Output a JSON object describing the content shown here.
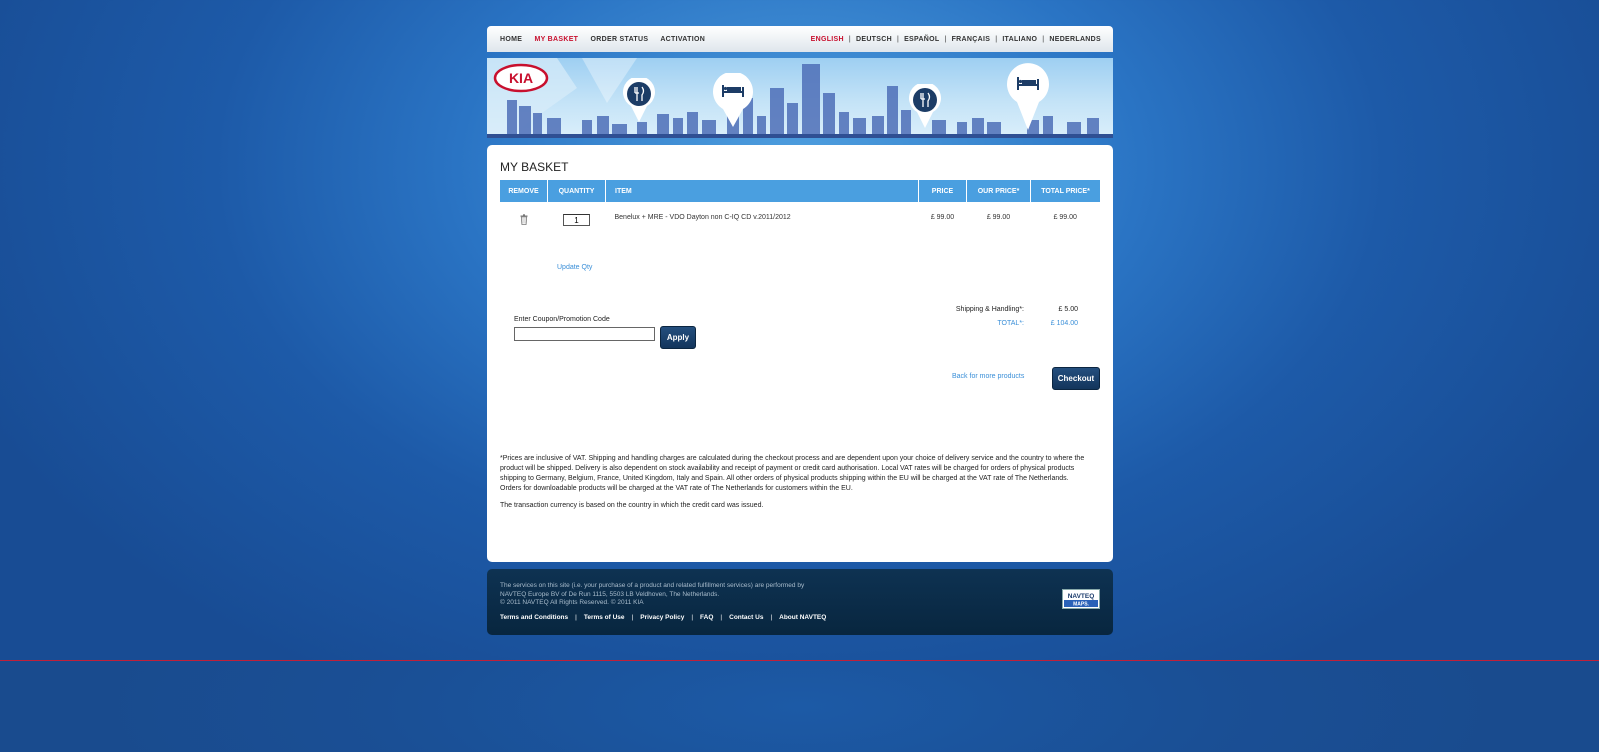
{
  "nav": {
    "items": [
      {
        "label": "HOME",
        "active": false
      },
      {
        "label": "MY BASKET",
        "active": true
      },
      {
        "label": "ORDER STATUS",
        "active": false
      },
      {
        "label": "ACTIVATION",
        "active": false
      }
    ],
    "languages": [
      "ENGLISH",
      "DEUTSCH",
      "ESPAÑOL",
      "FRANÇAIS",
      "ITALIANO",
      "NEDERLANDS"
    ],
    "active_language": "ENGLISH"
  },
  "banner": {
    "logo_text": "KIA",
    "icons": [
      "cutlery-icon",
      "bed-icon",
      "cutlery-icon",
      "bed-icon"
    ]
  },
  "basket": {
    "title": "MY BASKET",
    "columns": [
      "REMOVE",
      "QUANTITY",
      "ITEM",
      "PRICE",
      "OUR PRICE*",
      "TOTAL PRICE*"
    ],
    "rows": [
      {
        "quantity": "1",
        "item": "Benelux + MRE - VDO Dayton non C-IQ CD v.2011/2012",
        "price": "£ 99.00",
        "our_price": "£ 99.00",
        "total_price": "£ 99.00"
      }
    ],
    "update_label": "Update Qty",
    "coupon_label": "Enter Coupon/Promotion Code",
    "coupon_value": "",
    "apply_label": "Apply",
    "shipping_label": "Shipping & Handling*:",
    "shipping_value": "£ 5.00",
    "total_label": "TOTAL*:",
    "total_value": "£ 104.00",
    "back_label": "Back for more products",
    "checkout_label": "Checkout",
    "disclaimer": "*Prices are inclusive of VAT. Shipping and handling charges are calculated during the checkout process and are dependent upon your choice of delivery service and the country to where the product will be shipped. Delivery is also dependent on stock availability and receipt of payment or credit card authorisation. Local VAT rates will be charged for orders of physical products shipping to Germany, Belgium, France, United Kingdom, Italy and Spain. All other orders of physical products shipping within the EU will be charged at the VAT rate of The Netherlands. Orders for downloadable products will be charged at the VAT rate of The Netherlands for customers within the EU.",
    "currency_note": "The transaction currency is based on the country in which the credit card was issued."
  },
  "footer": {
    "line1": "The services on this site (i.e. your purchase of a product and related fulfillment services) are performed by",
    "line2": "NAVTEQ Europe BV of De Run 1115, 5503 LB Veldhoven, The Netherlands.",
    "line3": "© 2011 NAVTEQ All Rights Reserved. © 2011 KIA",
    "links": [
      "Terms and Conditions",
      "Terms of Use",
      "Privacy Policy",
      "FAQ",
      "Contact Us",
      "About NAVTEQ"
    ],
    "badge_top": "NAVTEQ",
    "badge_bottom": "MAPS."
  }
}
